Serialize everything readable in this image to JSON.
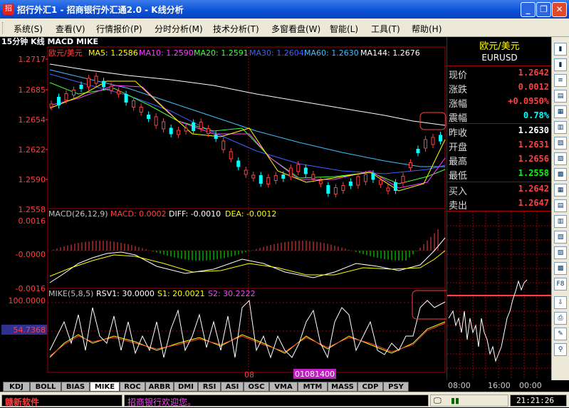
{
  "window": {
    "title": "招行外汇1 - 招商银行外汇通2.0 - K线分析",
    "app_icon": "招",
    "controls": [
      "_",
      "❐",
      "✕"
    ]
  },
  "menu": [
    "系统(S)",
    "查看(V)",
    "行情报价(P)",
    "分时分析(M)",
    "技术分析(T)",
    "多窗看盘(W)",
    "智能(L)",
    "工具(T)",
    "帮助(H)"
  ],
  "chart": {
    "header": "15分钟 K线 MACD MIKE",
    "pair_label": "欧元/美元",
    "ma": [
      {
        "label": "MA5: 1.2586",
        "color": "#ffff00"
      },
      {
        "label": "MA10: 1.2590",
        "color": "#ff40ff"
      },
      {
        "label": "MA20: 1.2591",
        "color": "#40ff40"
      },
      {
        "label": "MA30: 1.2604",
        "color": "#4060ff"
      },
      {
        "label": "MA60: 1.2630",
        "color": "#40c0ff"
      },
      {
        "label": "MA144: 1.2676",
        "color": "#ffffff"
      }
    ],
    "price_ticks": [
      "1.2717",
      "1.2685",
      "1.2654",
      "1.2622",
      "1.2590",
      "1.2558"
    ],
    "macd_header": [
      {
        "label": "MACD(26,12,9)",
        "color": "#c0c0c0"
      },
      {
        "label": "MACD: 0.0002",
        "color": "#ff4040"
      },
      {
        "label": "DIFF: -0.0010",
        "color": "#ffffff"
      },
      {
        "label": "DEA: -0.0012",
        "color": "#ffff00"
      }
    ],
    "macd_ticks": [
      "0.0016",
      "-0.0000",
      "-0.0016"
    ],
    "mike_header": [
      {
        "label": "MIKE(5,8,5)",
        "color": "#c0c0c0"
      },
      {
        "label": "RSV1: 30.0000",
        "color": "#ffffff"
      },
      {
        "label": "S1: 20.0021",
        "color": "#ffff00"
      },
      {
        "label": "S2: 30.2222",
        "color": "#ff40ff"
      }
    ],
    "mike_ticks": [
      "100.0000",
      "54.7368"
    ],
    "date_label": "08",
    "cursor_date": "01081400"
  },
  "quote": {
    "name": "欧元/美元",
    "code": "EURUSD",
    "rows": [
      {
        "label": "现价",
        "value": "1.2642",
        "color": "#ff4040"
      },
      {
        "label": "涨跌",
        "value": "0.0012",
        "color": "#ff4040"
      },
      {
        "label": "涨幅",
        "value": "+0.0950%",
        "color": "#ff4040"
      },
      {
        "label": "震幅",
        "value": "0.78%",
        "color": "#00ffff"
      },
      {
        "label": "昨收",
        "value": "1.2630",
        "color": "#ffffff"
      },
      {
        "label": "开盘",
        "value": "1.2631",
        "color": "#ff4040"
      },
      {
        "label": "最高",
        "value": "1.2656",
        "color": "#ff4040"
      },
      {
        "label": "最低",
        "value": "1.2558",
        "color": "#00ff00"
      },
      {
        "label": "买入",
        "value": "1.2642",
        "color": "#ff4040"
      },
      {
        "label": "卖出",
        "value": "1.2647",
        "color": "#ff4040"
      }
    ],
    "time_ticks": [
      "08:00",
      "16:00",
      "00:00"
    ]
  },
  "tabs": [
    "KDJ",
    "BOLL",
    "BIAS",
    "MIKE",
    "ROC",
    "ARBR",
    "DMI",
    "RSI",
    "ASI",
    "OSC",
    "VMA",
    "MTM",
    "MASS",
    "CDP",
    "PSY"
  ],
  "active_tab": "MIKE",
  "status": {
    "brand": "赣新软件",
    "message": "招商银行欢迎您。",
    "clock": "21:21:26"
  }
}
